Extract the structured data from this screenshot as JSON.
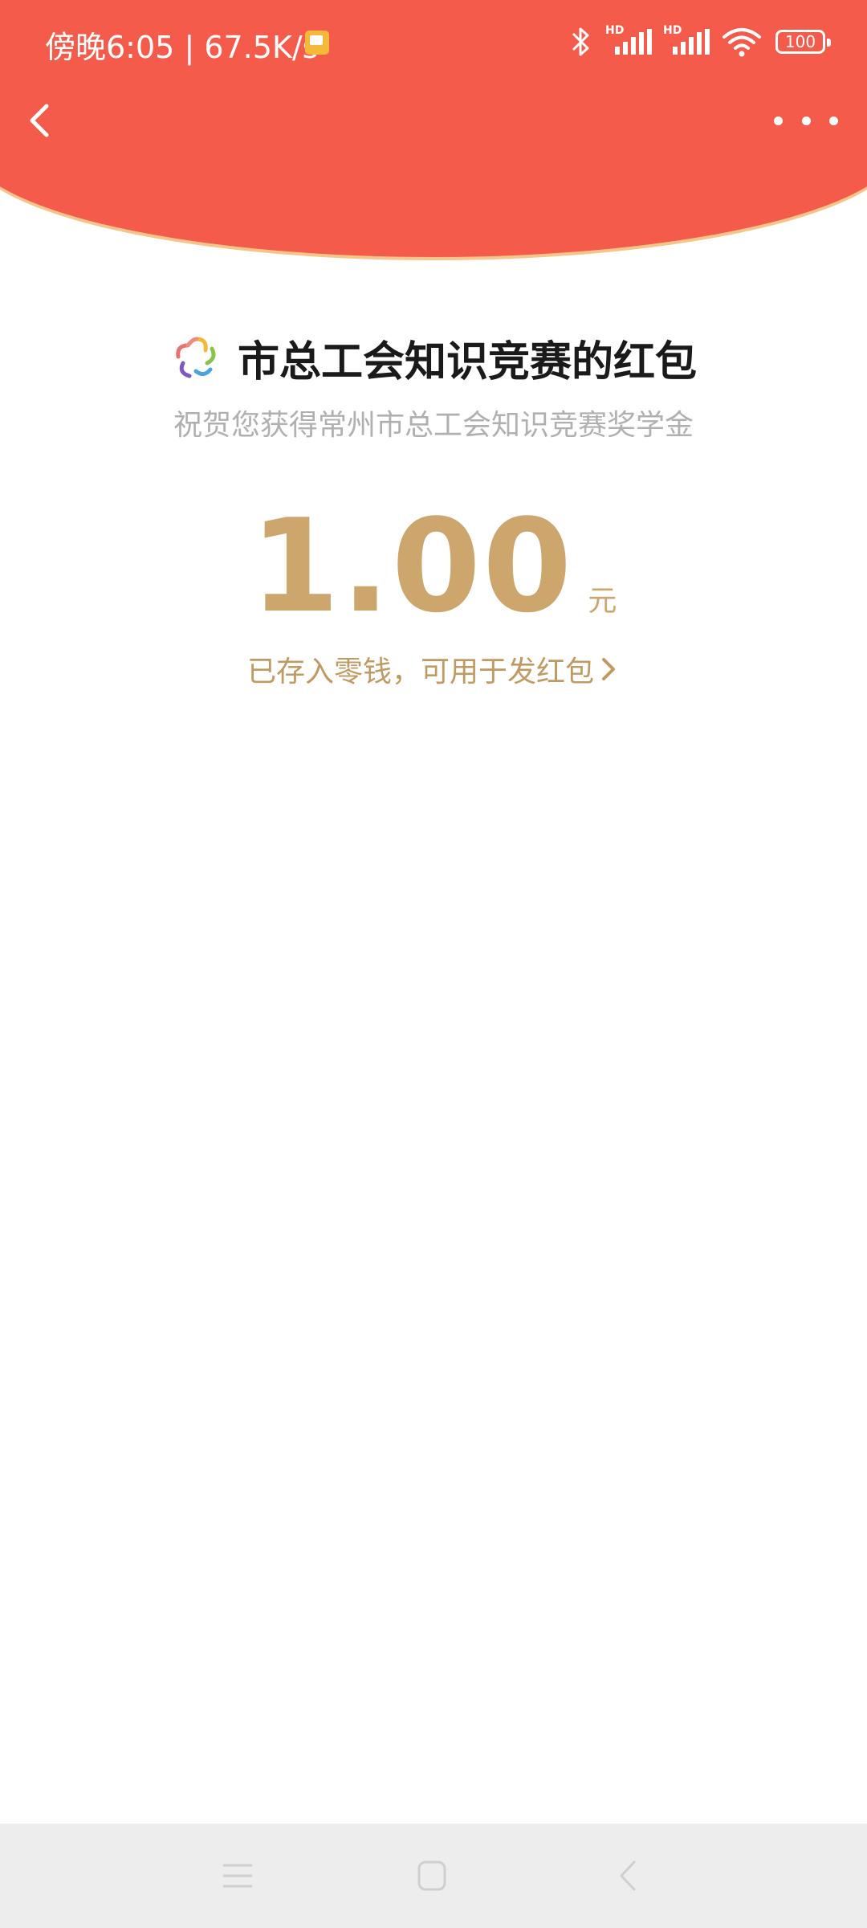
{
  "status_bar": {
    "time": "傍晚6:05",
    "speed": "67.5K/s",
    "battery": "100",
    "signal1_label": "HD",
    "signal2_label": "HD"
  },
  "top_hint": "",
  "nav": {
    "back_icon": "chevron-left-icon",
    "more_icon": "more-horizontal-icon"
  },
  "red_packet": {
    "title": "市总工会知识竞赛的红包",
    "subtitle": "祝贺您获得常州市总工会知识竞赛奖学金",
    "amount": "1.00",
    "unit": "元",
    "deposit_link": "已存入零钱，可用于发红包"
  },
  "colors": {
    "header_red": "#F55B4A",
    "gold": "#CDA66E",
    "subtitle_gray": "#B0B0B0"
  },
  "system_nav": {
    "menu_icon": "menu-icon",
    "home_icon": "home-icon",
    "back_icon": "back-icon"
  }
}
